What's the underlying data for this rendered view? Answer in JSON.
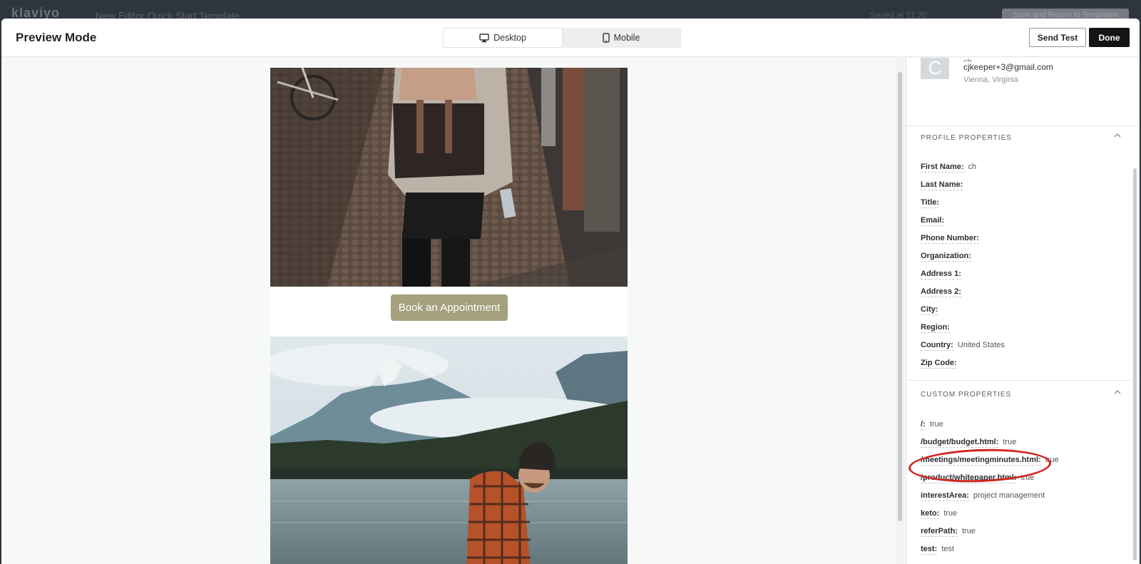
{
  "app_bar": {
    "brand": "klaviyo",
    "template_title": "New Editor Quick Start Template",
    "status": "Saved at 11:20",
    "save_return_label": "Save and Return to Templates"
  },
  "header": {
    "title": "Preview Mode",
    "tabs": [
      {
        "label": "Desktop",
        "icon": "desktop-icon",
        "active": true
      },
      {
        "label": "Mobile",
        "icon": "mobile-icon",
        "active": false
      }
    ],
    "send_test_label": "Send Test",
    "done_label": "Done"
  },
  "email": {
    "cta_label": "Book an Appointment",
    "cta_color": "#a5a07d"
  },
  "profile": {
    "avatar_initial": "C",
    "name": "ch",
    "email": "cjkeeper+3@gmail.com",
    "location": "Vienna, Virginia"
  },
  "profile_properties": {
    "heading": "PROFILE PROPERTIES",
    "items": [
      {
        "key": "First Name:",
        "value": "ch"
      },
      {
        "key": "Last Name:",
        "value": ""
      },
      {
        "key": "Title:",
        "value": ""
      },
      {
        "key": "Email:",
        "value": ""
      },
      {
        "key": "Phone Number:",
        "value": ""
      },
      {
        "key": "Organization:",
        "value": ""
      },
      {
        "key": "Address 1:",
        "value": ""
      },
      {
        "key": "Address 2:",
        "value": ""
      },
      {
        "key": "City:",
        "value": ""
      },
      {
        "key": "Region:",
        "value": ""
      },
      {
        "key": "Country:",
        "value": "United States"
      },
      {
        "key": "Zip Code:",
        "value": ""
      }
    ]
  },
  "custom_properties": {
    "heading": "CUSTOM PROPERTIES",
    "items": [
      {
        "key": "/:",
        "value": "true"
      },
      {
        "key": "/budget/budget.html:",
        "value": "true"
      },
      {
        "key": "/meetings/meetingminutes.html:",
        "value": "true"
      },
      {
        "key": "/product/whitepaper.html:",
        "value": "true"
      },
      {
        "key": "interestArea:",
        "value": "project management"
      },
      {
        "key": "keto:",
        "value": "true"
      },
      {
        "key": "referPath:",
        "value": "true"
      },
      {
        "key": "test:",
        "value": "test"
      }
    ]
  },
  "annotation": {
    "highlight_color": "#d0261f",
    "highlighted_item": "/product/whitepaper.html:"
  }
}
